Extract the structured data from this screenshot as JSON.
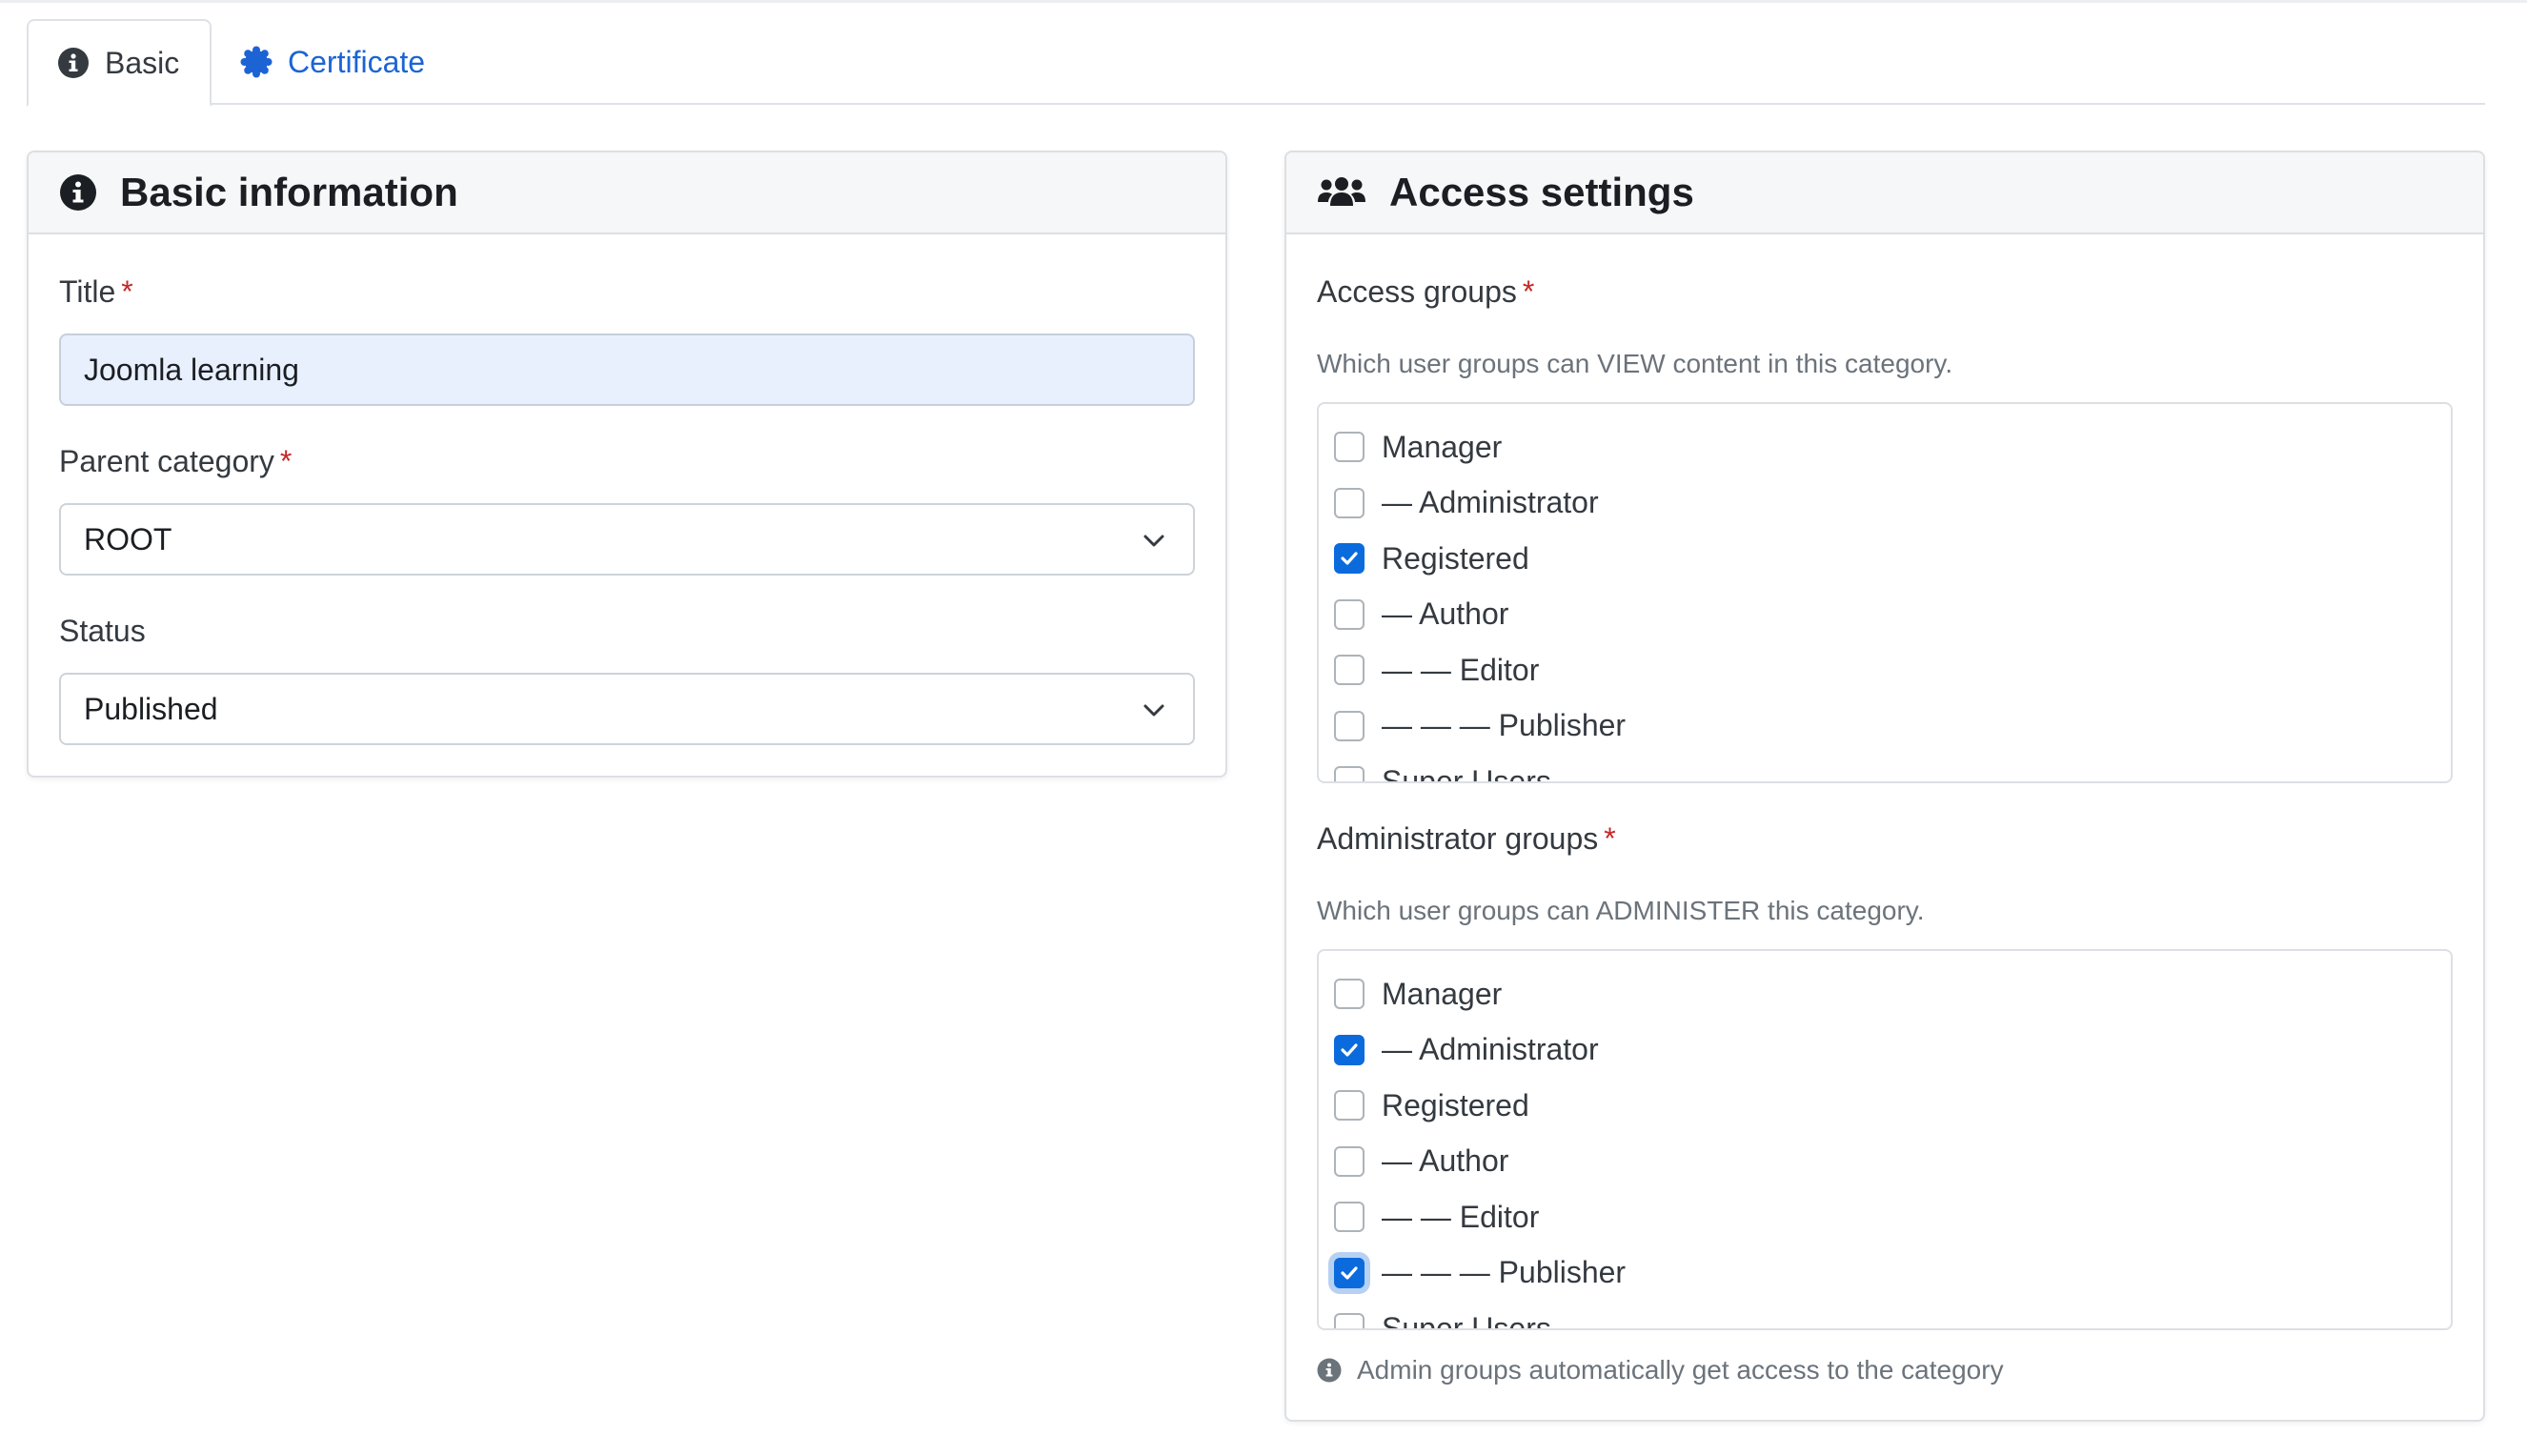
{
  "tabs": [
    {
      "label": "Basic",
      "icon": "info-icon",
      "active": true
    },
    {
      "label": "Certificate",
      "icon": "certificate-icon",
      "active": false
    }
  ],
  "basic_info": {
    "title": "Basic information",
    "title_field": {
      "label": "Title",
      "required_mark": "*",
      "value": "Joomla learning"
    },
    "parent_category": {
      "label": "Parent category",
      "required_mark": "*",
      "value": "ROOT"
    },
    "status": {
      "label": "Status",
      "value": "Published"
    }
  },
  "access_settings": {
    "title": "Access settings",
    "access_groups": {
      "label": "Access groups",
      "required_mark": "*",
      "description": "Which user groups can VIEW content in this category.",
      "items": [
        {
          "label": "Manager",
          "checked": false
        },
        {
          "label": "— Administrator",
          "checked": false
        },
        {
          "label": "Registered",
          "checked": true
        },
        {
          "label": "— Author",
          "checked": false
        },
        {
          "label": "— — Editor",
          "checked": false
        },
        {
          "label": "— — — Publisher",
          "checked": false
        },
        {
          "label": "Super Users",
          "checked": false
        }
      ]
    },
    "admin_groups": {
      "label": "Administrator groups",
      "required_mark": "*",
      "description": "Which user groups can ADMINISTER this category.",
      "items": [
        {
          "label": "Manager",
          "checked": false
        },
        {
          "label": "— Administrator",
          "checked": true
        },
        {
          "label": "Registered",
          "checked": false
        },
        {
          "label": "— Author",
          "checked": false
        },
        {
          "label": "— — Editor",
          "checked": false
        },
        {
          "label": "— — — Publisher",
          "checked": true
        },
        {
          "label": "Super Users",
          "checked": false
        }
      ]
    },
    "hint": "Admin groups automatically get access to the category"
  },
  "colors": {
    "accent": "#0b6bdd",
    "link": "#1c64d4",
    "required": "#c52827",
    "autofill": "#e8f0fe"
  }
}
